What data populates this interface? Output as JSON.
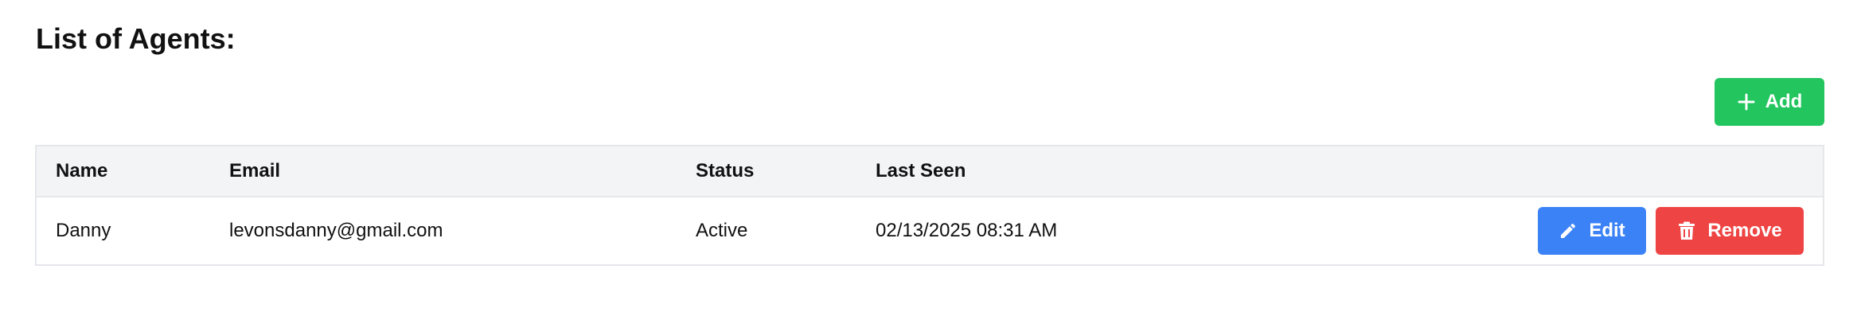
{
  "page": {
    "title": "List of Agents:"
  },
  "toolbar": {
    "add_label": "Add",
    "add_icon": "plus-icon"
  },
  "table": {
    "columns": [
      "Name",
      "Email",
      "Status",
      "Last Seen"
    ],
    "rows": [
      {
        "name": "Danny",
        "email": "levonsdanny@gmail.com",
        "status": "Active",
        "last_seen": "02/13/2025 08:31 AM",
        "actions": {
          "edit_label": "Edit",
          "edit_icon": "pencil-icon",
          "remove_label": "Remove",
          "remove_icon": "trash-icon"
        }
      }
    ]
  },
  "colors": {
    "add": "#22c55e",
    "edit": "#3b82f6",
    "remove": "#ef4444",
    "header_bg": "#f3f4f6",
    "border": "#e5e7eb"
  }
}
